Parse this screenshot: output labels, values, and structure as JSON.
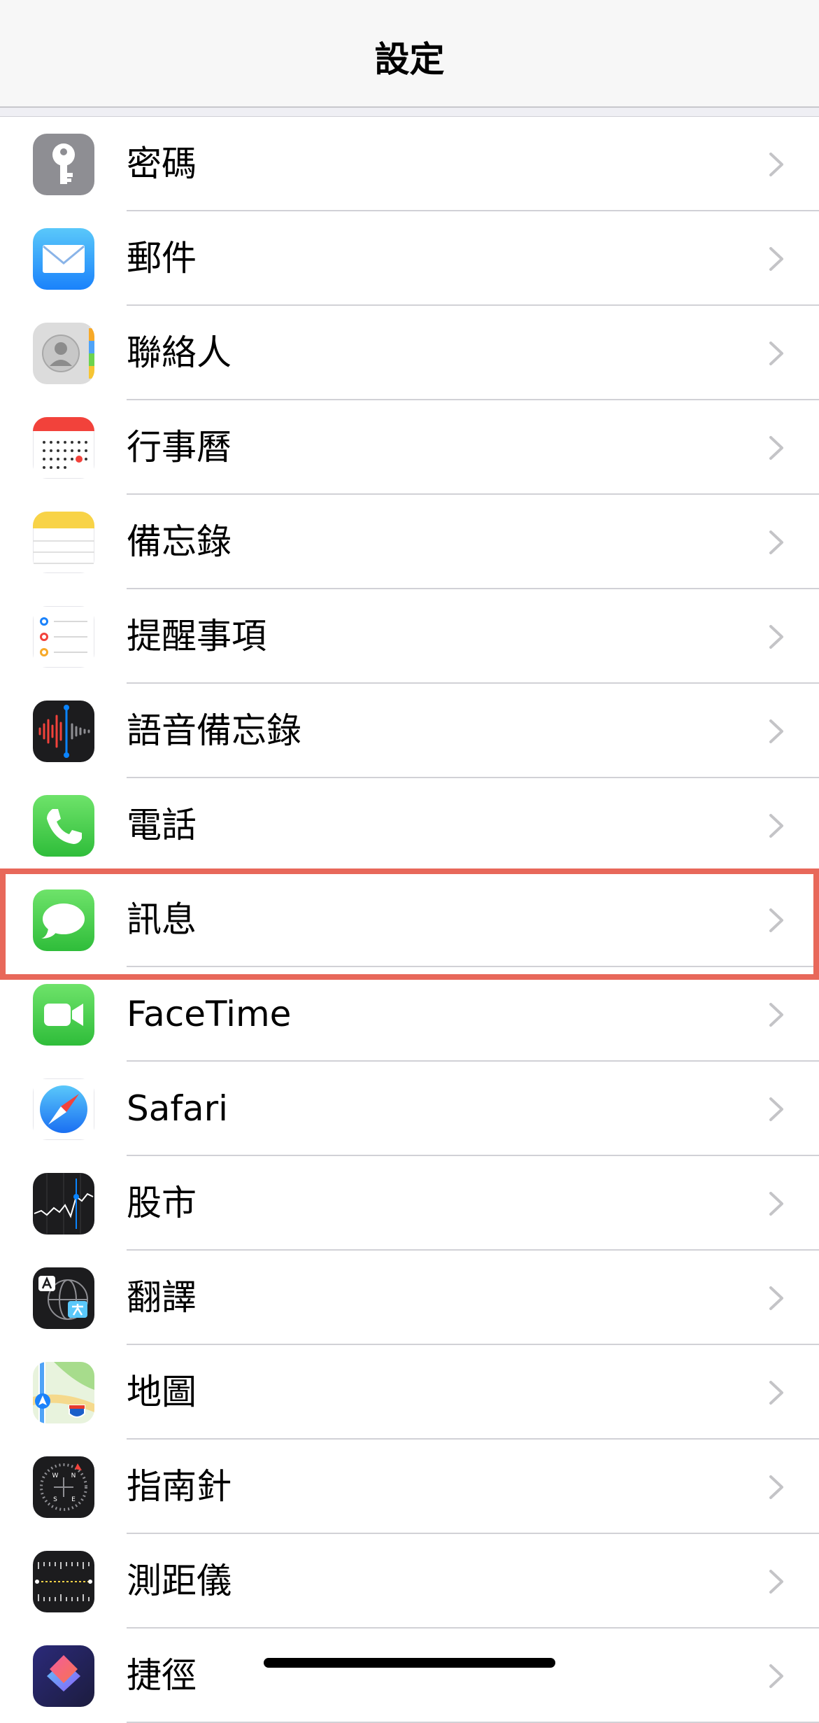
{
  "header": {
    "title": "設定"
  },
  "rows": [
    {
      "label": "密碼",
      "icon": "passwords-key-icon"
    },
    {
      "label": "郵件",
      "icon": "mail-envelope-icon"
    },
    {
      "label": "聯絡人",
      "icon": "contacts-icon"
    },
    {
      "label": "行事曆",
      "icon": "calendar-icon"
    },
    {
      "label": "備忘錄",
      "icon": "notes-icon"
    },
    {
      "label": "提醒事項",
      "icon": "reminders-icon"
    },
    {
      "label": "語音備忘錄",
      "icon": "voice-memos-waveform-icon"
    },
    {
      "label": "電話",
      "icon": "phone-handset-icon"
    },
    {
      "label": "訊息",
      "icon": "messages-bubble-icon",
      "highlighted": true
    },
    {
      "label": "FaceTime",
      "icon": "facetime-camera-icon"
    },
    {
      "label": "Safari",
      "icon": "safari-compass-icon"
    },
    {
      "label": "股市",
      "icon": "stocks-chart-icon"
    },
    {
      "label": "翻譯",
      "icon": "translate-icon"
    },
    {
      "label": "地圖",
      "icon": "maps-icon"
    },
    {
      "label": "指南針",
      "icon": "compass-icon"
    },
    {
      "label": "測距儀",
      "icon": "measure-ruler-icon"
    },
    {
      "label": "捷徑",
      "icon": "shortcuts-icon"
    }
  ],
  "colors": {
    "highlight_border": "#e8685a",
    "chevron": "#c4c4c7",
    "separator": "#d1d1d6"
  }
}
